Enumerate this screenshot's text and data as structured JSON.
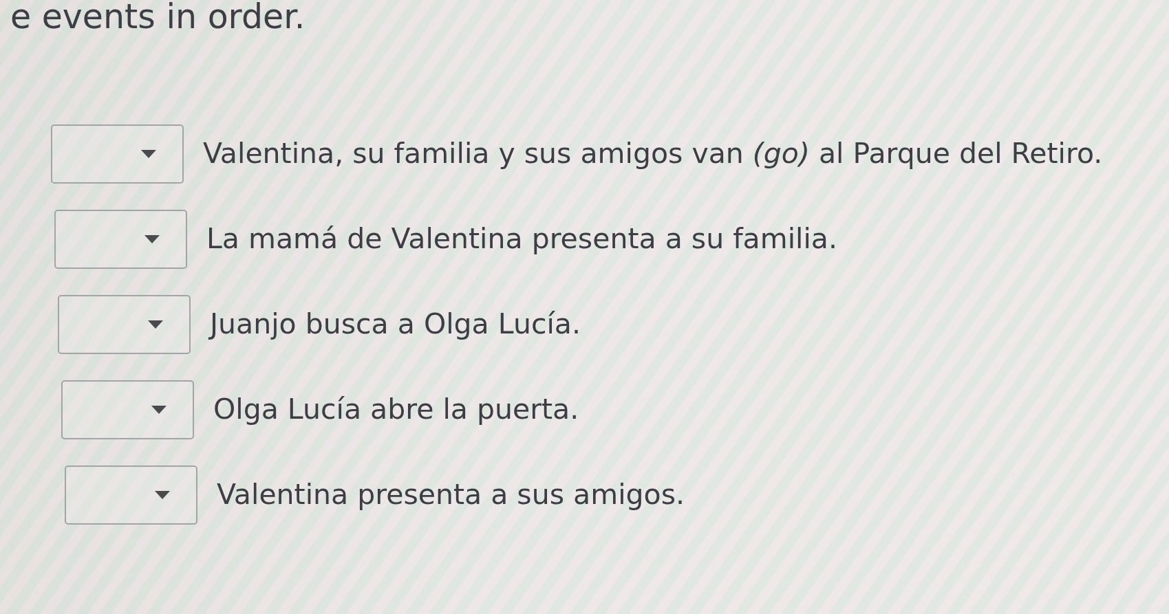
{
  "instruction": "e events in order.",
  "items": [
    {
      "text": "Valentina, su familia y sus amigos van *(go)* al Parque del Retiro."
    },
    {
      "text": "La mamá de Valentina presenta a su familia."
    },
    {
      "text": "Juanjo busca a Olga Lucía."
    },
    {
      "text": "Olga Lucía abre la puerta."
    },
    {
      "text": "Valentina presenta a sus amigos."
    }
  ]
}
